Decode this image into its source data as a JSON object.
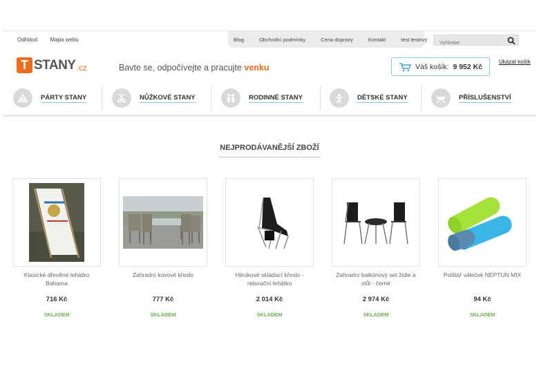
{
  "topbar": {
    "left_links": [
      "Odhlásit",
      "Mapa webu"
    ],
    "nav": [
      "Blog",
      "Obchodní podmínky",
      "Cena dopravy",
      "Kontakt",
      "test testový"
    ],
    "search_placeholder": "Vyhledat"
  },
  "header": {
    "logo_letter": "T",
    "logo_text": "STANY",
    "logo_tld": ".cz",
    "tagline": "Bavte se, odpočívejte a pracujte",
    "tagline_accent": "venku",
    "cart_label": "Váš košík:",
    "cart_total": "9 952 Kč",
    "show_cart": "Ukázat košík"
  },
  "categories": [
    {
      "label": "PÁRTY STANY",
      "icon": "tent-icon"
    },
    {
      "label": "NŮŽKOVÉ STANY",
      "icon": "scissors-icon"
    },
    {
      "label": "RODINNÉ STANY",
      "icon": "family-icon"
    },
    {
      "label": "DĚTSKÉ STANY",
      "icon": "kids-icon"
    },
    {
      "label": "PŘÍSLUŠENSTVÍ",
      "icon": "grill-icon"
    }
  ],
  "section_title": "NEJPRODÁVANĚJŠÍ ZBOŽÍ",
  "products": [
    {
      "name": "Klasické dřevěné lehátko Bahama",
      "price": "716 Kč",
      "stock": "SKLADEM"
    },
    {
      "name": "Zahradní kovové křeslo",
      "price": "777 Kč",
      "stock": "SKLADEM"
    },
    {
      "name": "Hliníkové skládací křeslo - relaxační lehátko",
      "price": "2 014 Kč",
      "stock": "SKLADEM"
    },
    {
      "name": "Zahradní balkónový set židle a stůl - černé",
      "price": "2 974 Kč",
      "stock": "SKLADEM"
    },
    {
      "name": "Polštář váleček NEPTUN MIX",
      "price": "94 Kč",
      "stock": "SKLADEM"
    }
  ],
  "colors": {
    "brand": "#ef6c1c",
    "stock": "#6ab04c",
    "cart_border": "#8ccbe0"
  }
}
